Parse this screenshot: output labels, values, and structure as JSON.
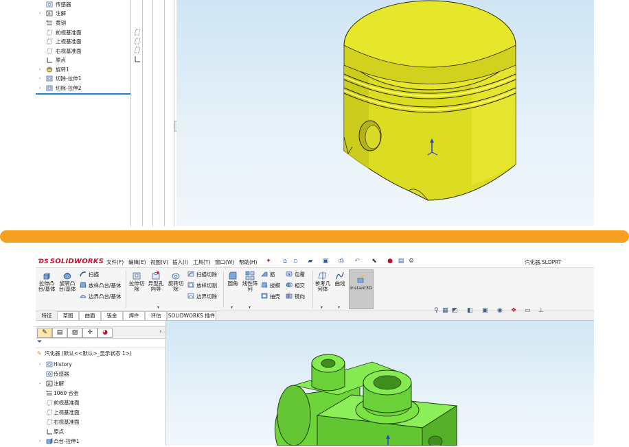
{
  "top_tree": {
    "items": [
      {
        "label": "传感器",
        "arrow": "",
        "icon": "sensor-icon"
      },
      {
        "label": "注解",
        "arrow": "›",
        "icon": "annotation-icon"
      },
      {
        "label": "黄铜",
        "arrow": "",
        "icon": "material-icon"
      },
      {
        "label": "前视基准面",
        "arrow": "",
        "icon": "plane-icon"
      },
      {
        "label": "上视基准面",
        "arrow": "",
        "icon": "plane-icon"
      },
      {
        "label": "右视基准面",
        "arrow": "",
        "icon": "plane-icon"
      },
      {
        "label": "原点",
        "arrow": "",
        "icon": "origin-icon"
      },
      {
        "label": "旋转1",
        "arrow": "›",
        "icon": "revolve-icon"
      },
      {
        "label": "切除-拉伸1",
        "arrow": "›",
        "icon": "cut-extrude-icon"
      },
      {
        "label": "切除-拉伸2",
        "arrow": "›",
        "icon": "cut-extrude-icon"
      }
    ]
  },
  "bottom": {
    "logo": "SOLIDWORKS",
    "menus": [
      "文件(F)",
      "编辑(E)",
      "视图(V)",
      "插入(I)",
      "工具(T)",
      "窗口(W)",
      "帮助(H)"
    ],
    "doc_title": "汽化器.SLDPRT",
    "ribbon": {
      "extrude_boss": "拉伸凸\n台/基体",
      "revolve_boss": "旋转凸\n台/基体",
      "sweep": "扫描",
      "loft": "放样凸台/基体",
      "boundary": "边界凸台/基体",
      "extrude_cut": "拉伸切\n除",
      "hole_wizard": "异型孔\n向导",
      "revolve_cut": "旋转切\n除",
      "swept_cut": "扫描切除",
      "lofted_cut": "放样切割",
      "boundary_cut": "边界切除",
      "fillet": "圆角",
      "linear_pattern": "线性阵\n列",
      "rib": "筋",
      "draft": "拔模",
      "shell": "抽壳",
      "wrap": "包覆",
      "intersect": "相交",
      "mirror": "镜向",
      "ref_geometry": "参考几\n何体",
      "curves": "曲线",
      "instant3d": "Instant3D"
    },
    "tabs": [
      "特征",
      "草图",
      "曲面",
      "钣金",
      "焊件",
      "评估",
      "SOLIDWORKS 插件"
    ],
    "tree": {
      "root": "汽化器 (默认<<默认>_显示状态 1>)",
      "items": [
        {
          "label": "History",
          "arrow": "›",
          "icon": "history-icon"
        },
        {
          "label": "传感器",
          "arrow": "",
          "icon": "sensor-icon"
        },
        {
          "label": "注解",
          "arrow": "›",
          "icon": "annotation-icon"
        },
        {
          "label": "1060 合金",
          "arrow": "",
          "icon": "material-icon"
        },
        {
          "label": "前视基准面",
          "arrow": "",
          "icon": "plane-icon"
        },
        {
          "label": "上视基准面",
          "arrow": "",
          "icon": "plane-icon"
        },
        {
          "label": "右视基准面",
          "arrow": "",
          "icon": "plane-icon"
        },
        {
          "label": "原点",
          "arrow": "",
          "icon": "origin-icon"
        },
        {
          "label": "凸台-拉伸1",
          "arrow": "›",
          "icon": "boss-extrude-icon"
        }
      ]
    }
  },
  "colors": {
    "accent_orange": "#f7a021",
    "piston_yellow": "#e6e62a",
    "part_green": "#7be244",
    "selection_blue": "#2a78c9"
  }
}
